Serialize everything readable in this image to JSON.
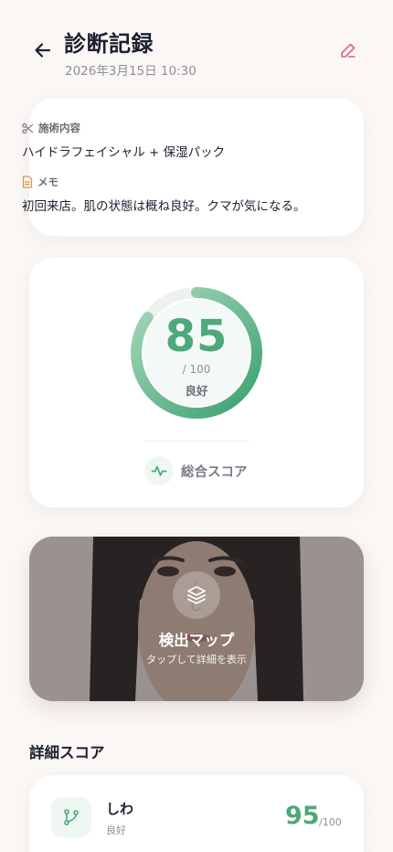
{
  "header": {
    "title": "診断記録",
    "date": "2026年3月15日 10:30"
  },
  "info": {
    "treatment_label": "施術内容",
    "treatment_value": "ハイドラフェイシャル + 保湿パック",
    "memo_label": "メモ",
    "memo_value": "初回来店。肌の状態は概ね良好。クマが気になる。"
  },
  "score": {
    "value": "85",
    "max": "/ 100",
    "rating": "良好",
    "label": "総合スコア",
    "fraction": 0.85
  },
  "map": {
    "title": "検出マップ",
    "subtitle": "タップして詳細を表示"
  },
  "details": {
    "section_title": "詳細スコア",
    "items": [
      {
        "name": "しわ",
        "rating": "良好",
        "score": "95",
        "max": "/100"
      }
    ]
  },
  "colors": {
    "accent_green": "#4da87a",
    "edit_pink": "#d9637e",
    "background": "#fbf7f5"
  },
  "icons": {
    "back": "arrow-left-icon",
    "edit": "pencil-icon",
    "treatment": "scissors-icon",
    "memo": "document-icon",
    "score_footer": "activity-pulse-icon",
    "map": "layers-icon",
    "detail": "branch-icon"
  }
}
